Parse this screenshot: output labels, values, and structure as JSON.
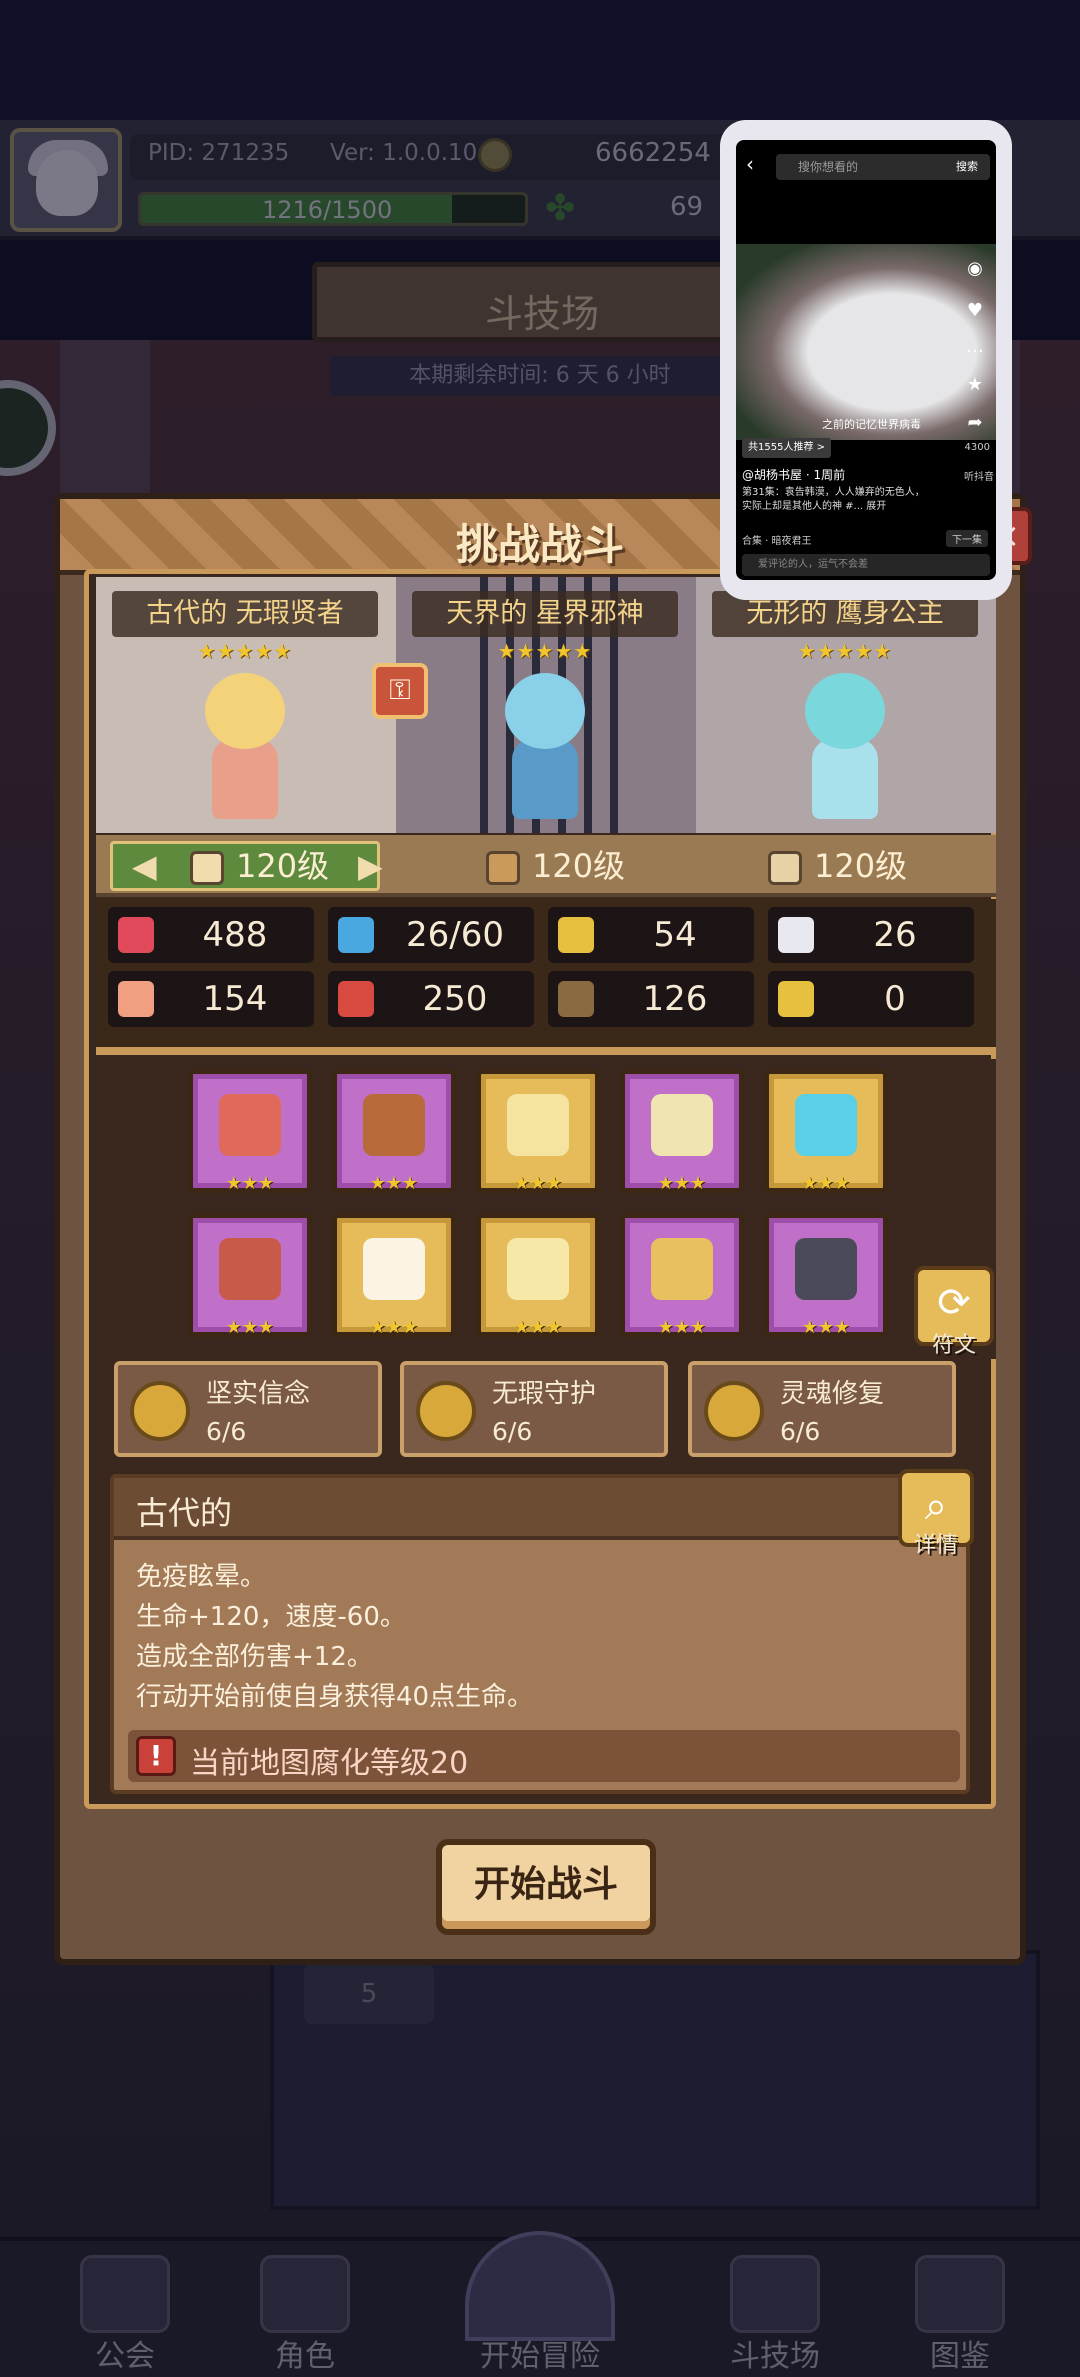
{
  "topbar": {
    "pid": "PID: 271235",
    "version": "Ver: 1.0.0.10",
    "gold": "6662254",
    "exp": "1216/1500",
    "exp_fraction": 0.81,
    "gems": "69"
  },
  "arena": {
    "title": "斗技场",
    "time_left": "本期剩余时间: 6 天 6 小时"
  },
  "stage": {
    "number": "5"
  },
  "dialog": {
    "title": "挑战战斗",
    "close": "×",
    "units": [
      {
        "name": "古代的 无瑕贤者",
        "stars": "★★★★★"
      },
      {
        "name": "天界的 星界邪神",
        "stars": "★★★★★"
      },
      {
        "name": "无形的 鹰身公主",
        "stars": "★★★★★"
      }
    ],
    "levels": [
      "120级",
      "120级",
      "120级"
    ],
    "stats": [
      {
        "icon": "heart-icon",
        "value": "488",
        "color": "#e04a5a"
      },
      {
        "icon": "water-drop-icon",
        "value": "26/60",
        "color": "#4aa8e0"
      },
      {
        "icon": "shield-icon",
        "value": "54",
        "color": "#e8c040"
      },
      {
        "icon": "wing-icon",
        "value": "26",
        "color": "#e8e8f0"
      },
      {
        "icon": "fist-icon",
        "value": "154",
        "color": "#f0a080"
      },
      {
        "icon": "book-icon",
        "value": "250",
        "color": "#d84a40"
      },
      {
        "icon": "scroll-icon",
        "value": "126",
        "color": "#8a6a40"
      },
      {
        "icon": "horseshoe-icon",
        "value": "0",
        "color": "#e8c040"
      }
    ],
    "equipment": [
      {
        "icon": "axe-icon",
        "rarity": "purple",
        "stars": "★★★"
      },
      {
        "icon": "shield-emblem-icon",
        "rarity": "purple",
        "stars": "★★★"
      },
      {
        "icon": "necklace-icon",
        "rarity": "gold",
        "stars": "★★★"
      },
      {
        "icon": "helmet-icon",
        "rarity": "purple",
        "stars": "★★★"
      },
      {
        "icon": "ring-icon",
        "rarity": "gold",
        "stars": "★★★"
      },
      {
        "icon": "beast-helm-icon",
        "rarity": "purple",
        "stars": "★★★"
      },
      {
        "icon": "wings-icon",
        "rarity": "gold",
        "stars": "★★★"
      },
      {
        "icon": "scroll-item-icon",
        "rarity": "gold",
        "stars": "★★★"
      },
      {
        "icon": "bracelet-icon",
        "rarity": "purple",
        "stars": "★★★"
      },
      {
        "icon": "boots-icon",
        "rarity": "purple",
        "stars": "★★★"
      }
    ],
    "rune_label": "符文",
    "skills": [
      {
        "name": "坚实信念",
        "count": "6/6"
      },
      {
        "name": "无瑕守护",
        "count": "6/6"
      },
      {
        "name": "灵魂修复",
        "count": "6/6"
      }
    ],
    "description": {
      "title": "古代的",
      "lines": [
        "免疫眩晕。",
        "生命+120，速度-60。",
        "造成全部伤害+12。",
        "行动开始前使自身获得40点生命。"
      ],
      "warning": "当前地图腐化等级20"
    },
    "detail_label": "详情",
    "start_button": "开始战斗"
  },
  "bottom_nav": [
    "公会",
    "角色",
    "开始冒险",
    "斗技场",
    "图鉴"
  ],
  "video": {
    "search_placeholder": "搜你想看的",
    "search_btn": "搜索",
    "caption": "之前的记忆世界病毒",
    "likes": "4300",
    "listen": "听抖音",
    "tag": "共1555人推荐 >",
    "author": "@胡杨书屋 · 1周前",
    "text": "第31集：袁告韩漠，人人嫌弃的无色人，实际上却是其他人的神 #... 展开",
    "collection": "合集 · 暗夜君王",
    "next": "下一集",
    "comment_placeholder": "爱评论的人，运气不会差"
  }
}
